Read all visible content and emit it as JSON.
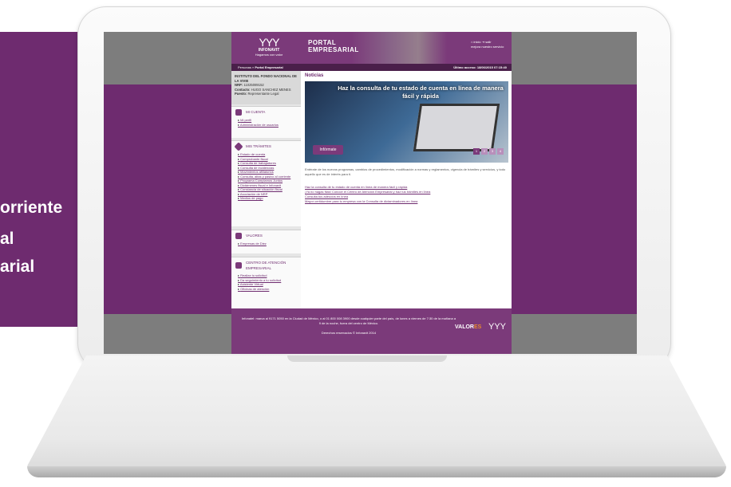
{
  "promo": {
    "lines": [
      "orriente",
      "al",
      "arial"
    ]
  },
  "site": {
    "logo": {
      "mark": "YYY",
      "name": "INFONAVIT",
      "tagline": "Hagamos con valor"
    },
    "portal_title_1": "PORTAL",
    "portal_title_2": "EMPRESARIAL",
    "header_links": [
      "inicio",
      "salir",
      "mejora nuestro servicio"
    ],
    "breadcrumb": {
      "home": "Personas",
      "sep": "»",
      "current": "Portal Empresarial"
    },
    "last_access": "Último acceso: 18/06/2015 07:15:40",
    "user": {
      "company": "INSTITUTO DEL FONDO NACIONAL DE LA VIVIE",
      "nrp_label": "NRP:",
      "nrp": "11025089152",
      "contact_label": "Contacto:",
      "contact": "HUGO SANCHEZ MENES",
      "role_label": "Puesto:",
      "role": "Representante Legal"
    },
    "sections": [
      {
        "title": "MI CUENTA",
        "icon": "user-icon",
        "items": [
          "Mi perfil",
          "Administración de usuarios"
        ]
      },
      {
        "title": "MIS TRÁMITES",
        "icon": "diamond-icon",
        "items": [
          "Estado de cuenta",
          "Comprobante fiscal",
          "Consulta de trabajadores",
          "Consulta de incidencias",
          "Movimientos afiliatorios",
          "Consulta, altas y pasivo al corriente",
          "Programa Cumplamos Juntos",
          "Dictámenes fiscal e Infonavit",
          "Constancia de situación fiscal",
          "Asociación de NRP",
          "Medios de pago"
        ]
      },
      {
        "title": "VALORES",
        "icon": "building-icon",
        "items": [
          "Empresas de Diez"
        ]
      },
      {
        "title": "CENTRO DE ATENCIÓN EMPRESARIAL",
        "icon": "briefcase-icon",
        "items": [
          "Realiza tu solicitud",
          "Da seguimiento a tu solicitud",
          "Asistente Virtual",
          "Oficinas de atención"
        ]
      }
    ],
    "news_title": "Noticias",
    "slide_caption": "Haz la consulta de tu estado de cuenta en línea de manera fácil y rápida",
    "slide_button": "Infórmate",
    "slide_pages": [
      "1",
      "2",
      "3",
      "4"
    ],
    "intro": "Entérate de los nuevos programas, cambios de procedimientos, modificación a normas y reglamentos, vigencia de trámites y servicios, y todo aquello que es de interés para ti.",
    "news_links": [
      "Haz la consulta de tu estado de cuenta en línea de manera fácil y rápida",
      "¡Ya no hagas filas! Conoce el Centro de Atención Empresarial y haz tus trámites en línea",
      "Consulta tus adeudos en línea",
      "Mayor certidumbre para tu empresa con la Consulta de dictaminadores en línea"
    ],
    "footer_text": "Infonatel: marca al 9171 5050 en la Ciudad de México, o al 01 800 008 3900 desde cualquier parte del país, de lunes a viernes de 7:30 de la mañana a 9 de la noche, fuera del centro de México.",
    "footer_rights": "Derechos reservados © Infonavit 2014",
    "footer_valores_a": "VALOR",
    "footer_valores_b": "ES",
    "footer_logo": "YYY"
  }
}
